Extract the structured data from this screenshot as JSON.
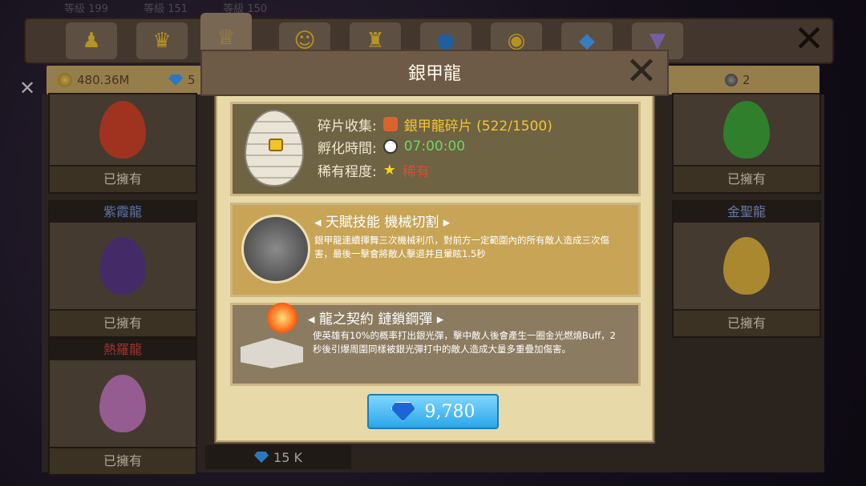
{
  "background_levels": [
    "等級 199",
    "等級 151",
    "等級 150"
  ],
  "tabs": [
    {
      "icon": "trophy-figure-icon"
    },
    {
      "icon": "dragon-crown-icon"
    },
    {
      "icon": "crown-icon"
    },
    {
      "icon": "character-icon"
    },
    {
      "icon": "cup-icon"
    },
    {
      "icon": "orb-icon"
    },
    {
      "icon": "eye-ring-icon"
    },
    {
      "icon": "gem-icon"
    },
    {
      "icon": "shirt-icon"
    }
  ],
  "resources": {
    "gold": "480.36M",
    "gems": "5",
    "ball": "2"
  },
  "cards": [
    {
      "title": "",
      "owned": "已擁有",
      "egg_color": "#d4452a"
    },
    {
      "title": "紫霞龍",
      "owned": "已擁有",
      "egg_color": "#5b3a8a",
      "title_color": "#7a9ad8"
    },
    {
      "title": "熱羅龍",
      "owned": "已擁有",
      "egg_color": "#c77bc2",
      "title_color": "#d24545"
    },
    {
      "title": "",
      "owned": "已擁有",
      "egg_color": "#3faa3d"
    },
    {
      "title": "金聖龍",
      "owned": "已擁有",
      "egg_color": "#e2b640",
      "title_color": "#8aa0d8"
    }
  ],
  "strip_price": "15 K",
  "modal": {
    "title": "銀甲龍",
    "info": {
      "fragment_label": "碎片收集:",
      "fragment_value": "銀甲龍碎片 (522/1500)",
      "hatch_label": "孵化時間:",
      "hatch_value": "07:00:00",
      "rarity_label": "稀有程度:",
      "rarity_value": "稀有"
    },
    "skill": {
      "heading": "◂ 天賦技能  機械切割 ▸",
      "description": "銀甲龍連續揮舞三次機械利爪，對前方一定範圍內的所有敵人造成三次傷害，最後一擊會將敵人擊退并且暈眩1.5秒"
    },
    "contract": {
      "heading": "◂ 龍之契約  鏈鎖鋼彈 ▸",
      "description": "使英雄有10%的概率打出銀光彈，擊中敵人後會產生一圈金光燃燒Buff，2秒後引爆周圍同樣被銀光彈打中的敵人造成大量多重疊加傷害。"
    },
    "price": "9,780"
  }
}
